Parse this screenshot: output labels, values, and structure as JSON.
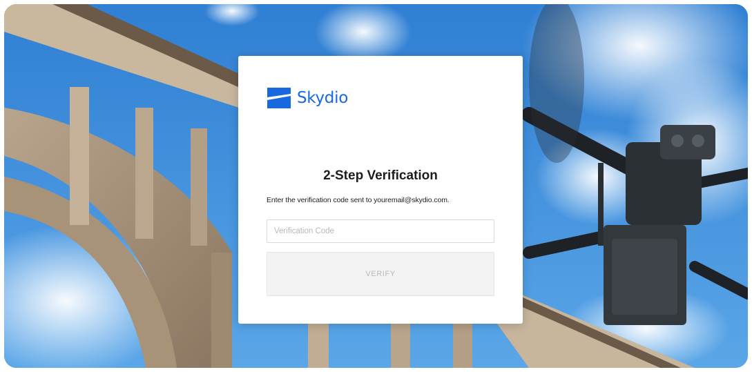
{
  "brand": {
    "name": "Skydio",
    "logo_icon": "skydio-logo-icon",
    "color": "#1769e0"
  },
  "verification": {
    "title": "2-Step Verification",
    "instructions": "Enter the verification code sent to youremail@skydio.com.",
    "code_input": {
      "placeholder": "Verification Code",
      "value": ""
    },
    "verify_label": "VERIFY"
  },
  "background": {
    "description_icon": "bridge-and-drone-photo",
    "sky_color": "#3f8fdc"
  }
}
